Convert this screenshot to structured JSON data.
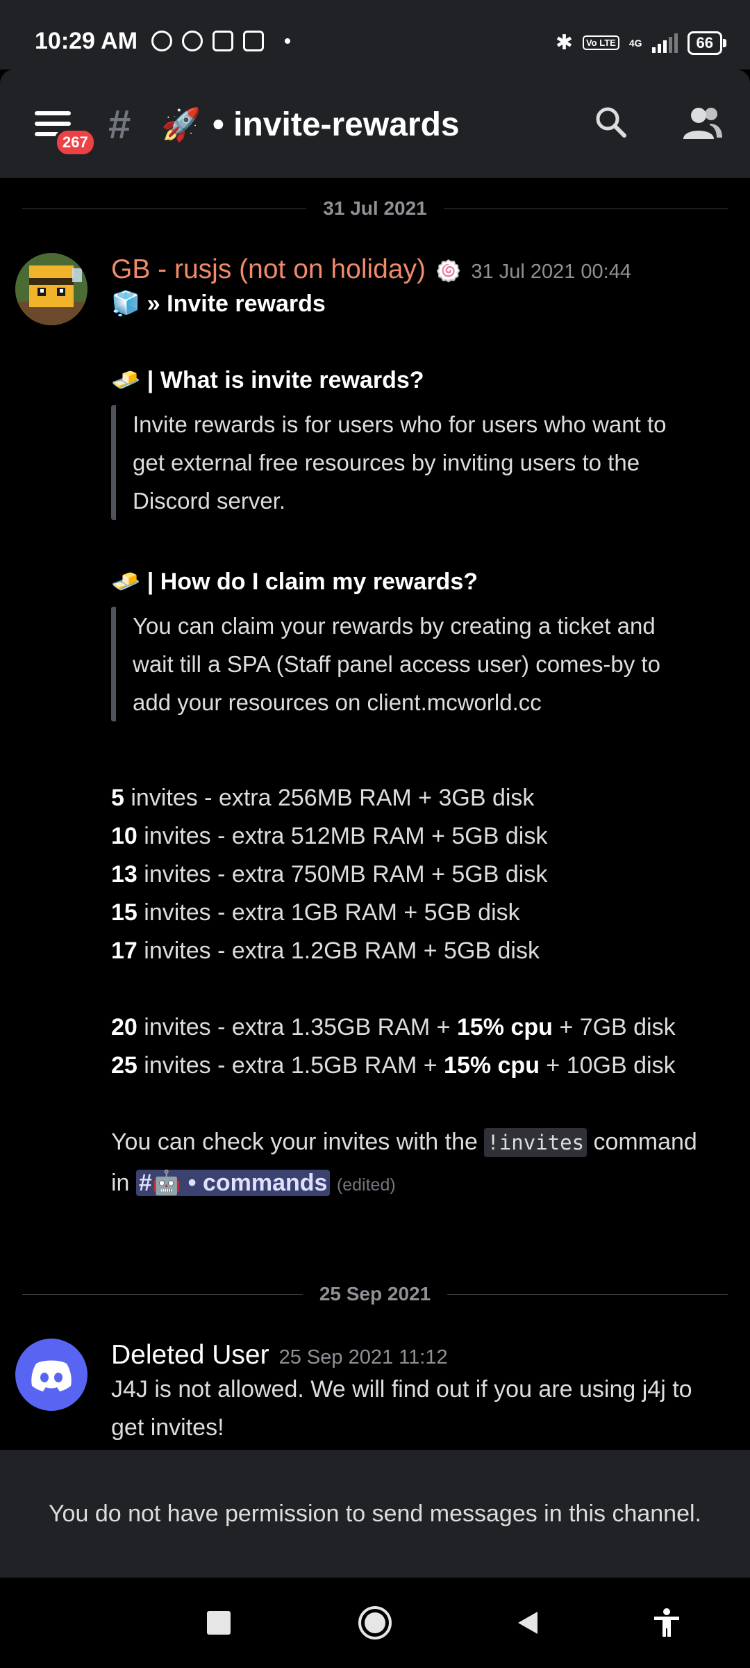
{
  "status_bar": {
    "time": "10:29 AM",
    "network": "4G",
    "battery": "66",
    "volte": "Vo LTE"
  },
  "header": {
    "badge_count": "267",
    "hash": "#",
    "channel_emoji": "🚀",
    "channel_name": "• invite-rewards"
  },
  "dividers": {
    "first": "31 Jul 2021",
    "second": "25 Sep 2021"
  },
  "message1": {
    "author": "GB - rusjs (not on holiday)",
    "timestamp": "31 Jul 2021 00:44",
    "role_emoji": "🍥",
    "title_emoji": "🧊",
    "title": "» Invite rewards",
    "q1_emoji": "🧈",
    "q1": "| What is invite rewards?",
    "q1_answer": [
      "Invite rewards is for users who for users who want to",
      "get external free resources by inviting users to the",
      "Discord server."
    ],
    "q2_emoji": "🧈",
    "q2": " | How do I claim my rewards?",
    "q2_answer": [
      "You can claim your rewards by creating a ticket and",
      "wait till a SPA (Staff panel access user) comes-by to",
      "add your resources on client.mcworld.cc"
    ],
    "tiers": [
      {
        "count": "5",
        "text": " invites - extra 256MB RAM + 3GB disk"
      },
      {
        "count": "10",
        "text": " invites - extra 512MB RAM + 5GB disk"
      },
      {
        "count": "13",
        "text": " invites - extra 750MB RAM + 5GB disk"
      },
      {
        "count": "15",
        "text": " invites - extra 1GB RAM + 5GB disk"
      },
      {
        "count": "17",
        "text": " invites - extra 1.2GB RAM + 5GB disk"
      }
    ],
    "tiers_cpu": [
      {
        "count": "20",
        "pre": " invites - extra 1.35GB RAM + ",
        "cpu": "15% cpu",
        "post": " + 7GB disk"
      },
      {
        "count": "25",
        "pre": " invites - extra 1.5GB RAM + ",
        "cpu": "15% cpu",
        "post": " + 10GB disk"
      }
    ],
    "check_pre": "You can check your invites with the ",
    "check_code": "!invites",
    "check_post": " command",
    "in_text": "in ",
    "mention": "#🤖 • commands",
    "edited": "(edited)"
  },
  "message2": {
    "author": "Deleted User",
    "timestamp": "25 Sep 2021 11:12",
    "lines": [
      "J4J is not allowed. We will find out if you are using j4j to",
      "get invites!"
    ]
  },
  "footer": {
    "no_permission": "You do not have permission to send messages in this channel."
  },
  "colors": {
    "author_accent": "#f08b6a",
    "mention_bg": "#3c4270",
    "discord_blurple": "#5865f2",
    "badge_red": "#ed4245"
  }
}
